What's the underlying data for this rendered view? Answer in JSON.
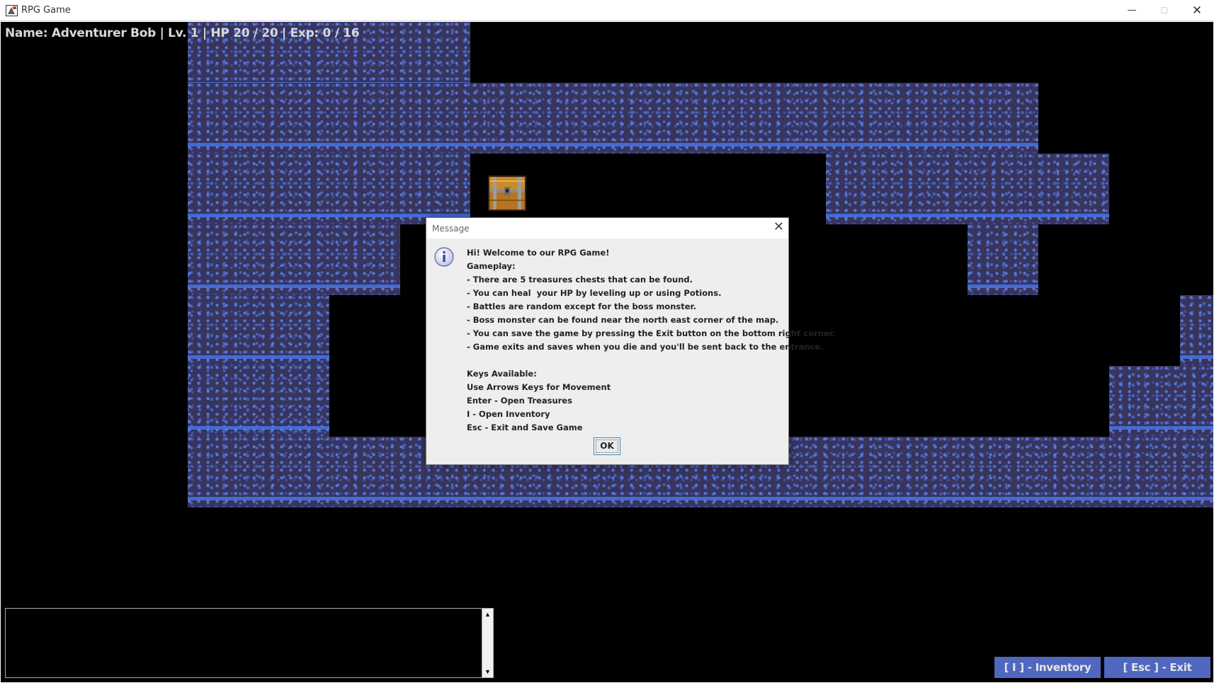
{
  "window": {
    "title": "RPG Game",
    "controls": {
      "minimize": "—",
      "maximize": "☐",
      "close": "✕"
    }
  },
  "hud": {
    "status_text": "Name: Adventurer Bob | Lv. 1 | HP 20 / 20 | Exp: 0 / 16"
  },
  "dialog": {
    "title": "Message",
    "close_symbol": "✕",
    "icon": "info-icon",
    "lines": [
      "Hi! Welcome to our RPG Game!",
      "Gameplay:",
      "- There are 5 treasures chests that can be found.",
      "- You can heal  your HP by leveling up or using Potions.",
      "- Battles are random except for the boss monster.",
      "- Boss monster can be found near the north east corner of the map.",
      "- You can save the game by pressing the Exit button on the bottom right corner.",
      "- Game exits and saves when you die and you'll be sent back to the entrance.",
      "",
      "Keys Available:",
      "Use Arrows Keys for Movement",
      "Enter - Open Treasures",
      "I - Open Inventory",
      "Esc - Exit and Save Game"
    ],
    "ok_label": "OK"
  },
  "log_panel": {
    "text": "",
    "scroll_up": "▲",
    "scroll_down": "▼"
  },
  "buttons": {
    "inventory_label": "[ I ] - Inventory",
    "exit_label": "[ Esc ] - Exit"
  },
  "map": {
    "icons": [
      "treasure-chest-icon"
    ]
  },
  "colors": {
    "rock_base": "#38345c",
    "rock_highlight": "#5c84e6",
    "background": "#000000",
    "button_blue": "#4f67bf"
  }
}
